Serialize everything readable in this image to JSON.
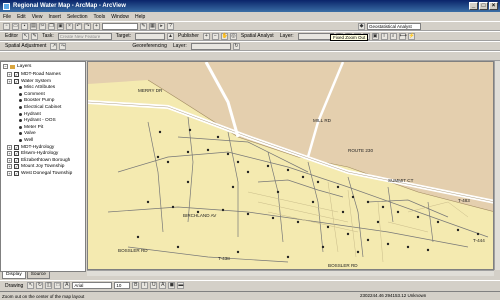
{
  "window": {
    "title": "Regional Water Map - ArcMap - ArcView"
  },
  "menu": [
    "File",
    "Edit",
    "View",
    "Insert",
    "Selection",
    "Tools",
    "Window",
    "Help"
  ],
  "toolbar1": {
    "scale": "",
    "dropdown": "Geostatistical Analyst"
  },
  "toolbar2": {
    "editor": "Editor",
    "task_label": "Task:",
    "task_value": "Create New Feature",
    "target_label": "Target:",
    "publisher": "Publisher",
    "spatial_analyst": "Spatial Analyst",
    "layer_label": "Layer:"
  },
  "toolbar3": {
    "spatial_adjustment": "Spatial Adjustment",
    "georeferencing": "Georeferencing",
    "layer_label": "Layer:"
  },
  "tooltip": "Fixed Zoom Out",
  "toc": {
    "root": "Layers",
    "items": [
      {
        "label": "MDT-Road Names",
        "checked": true
      },
      {
        "label": "Water System",
        "checked": true
      },
      {
        "label": "Misc Attributes",
        "checked": false,
        "sub": true
      },
      {
        "label": "Comment",
        "checked": false,
        "sub": true
      },
      {
        "label": "Booster Pump",
        "checked": false,
        "sub": true
      },
      {
        "label": "Electrical Cabinet",
        "checked": false,
        "sub": true
      },
      {
        "label": "Hydrant",
        "checked": false,
        "sub": true
      },
      {
        "label": "Hydrant - OOS",
        "checked": false,
        "sub": true
      },
      {
        "label": "Meter Pit",
        "checked": false,
        "sub": true
      },
      {
        "label": "Valve",
        "checked": false,
        "sub": true
      },
      {
        "label": "Well",
        "checked": false,
        "sub": true
      },
      {
        "label": "MDT-Hydrology",
        "checked": true
      },
      {
        "label": "Elswm-Hydrology",
        "checked": true
      },
      {
        "label": "Elizabethtown Borough",
        "checked": true
      },
      {
        "label": "Mount Joy Township",
        "checked": true
      },
      {
        "label": "West Donegal Township",
        "checked": true
      }
    ],
    "tabs": [
      "Display",
      "Source"
    ]
  },
  "map_labels": [
    "MERRY DR",
    "BIRCHLAND AV",
    "BOSSLER RD",
    "BOSSLER RD",
    "T-438",
    "T-444",
    "MILL RD",
    "SUMMIT CT",
    "T-483",
    "ROUTE 230"
  ],
  "colors": {
    "township": "#e4cfae",
    "borough": "#f4eab0",
    "road": "#ffffff",
    "pipe": "#777777",
    "feature": "#222222"
  },
  "drawing": {
    "label": "Drawing",
    "font": "Arial",
    "size": "10"
  },
  "status": {
    "message": "Zoom out on the center of the map layout",
    "coords": "2302244.46  294153.12 Unknown"
  }
}
